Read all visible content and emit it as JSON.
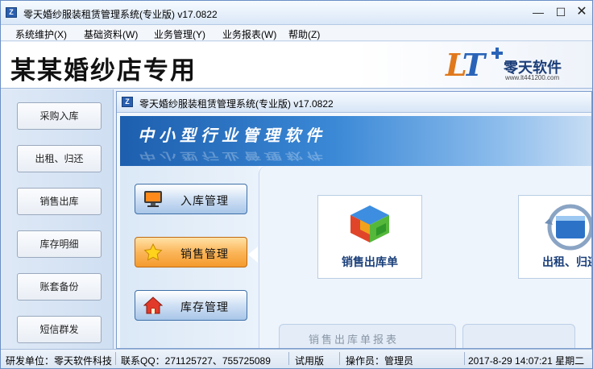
{
  "window": {
    "title": "零天婚纱服装租赁管理系统(专业版)  v17.0822",
    "icon_name": "app-icon",
    "minimize": "—",
    "maximize": "☐",
    "close": "✕"
  },
  "menu": [
    "系统维护(X)",
    "基础资料(W)",
    "业务管理(Y)",
    "业务报表(W)",
    "帮助(Z)"
  ],
  "banner": {
    "shop_title": "某某婚纱店专用",
    "logo_lt": "LT",
    "logo_name": "零天软件",
    "logo_url": "www.lt441200.com"
  },
  "left_nav": [
    "采购入库",
    "出租、归还",
    "销售出库",
    "库存明细",
    "账套备份",
    "短信群发"
  ],
  "inner_window": {
    "title": "零天婚纱服装租赁管理系统(专业版)  v17.0822",
    "banner_text": "中小型行业管理软件",
    "modules": [
      {
        "label": "入库管理",
        "icon": "monitor-icon",
        "active": false
      },
      {
        "label": "销售管理",
        "icon": "star-icon",
        "active": true
      },
      {
        "label": "库存管理",
        "icon": "house-icon",
        "active": false
      }
    ],
    "tiles": [
      {
        "label": "销售出库单",
        "icon": "puzzle-blocks-icon"
      },
      {
        "label": "出租、归还",
        "icon": "refresh-window-icon"
      }
    ],
    "report_label": "销售出库单报表"
  },
  "status_bar": {
    "developer": "研发单位：零天软件科技",
    "qq": "联系QQ：271125727、755725089",
    "edition": "试用版",
    "operator": "操作员：管理员",
    "datetime": "2017-8-29 14:07:21 星期二"
  },
  "colors": {
    "accent_blue": "#2a64b8",
    "accent_orange": "#f49a2c",
    "title_bar": "#d9e7f7"
  }
}
